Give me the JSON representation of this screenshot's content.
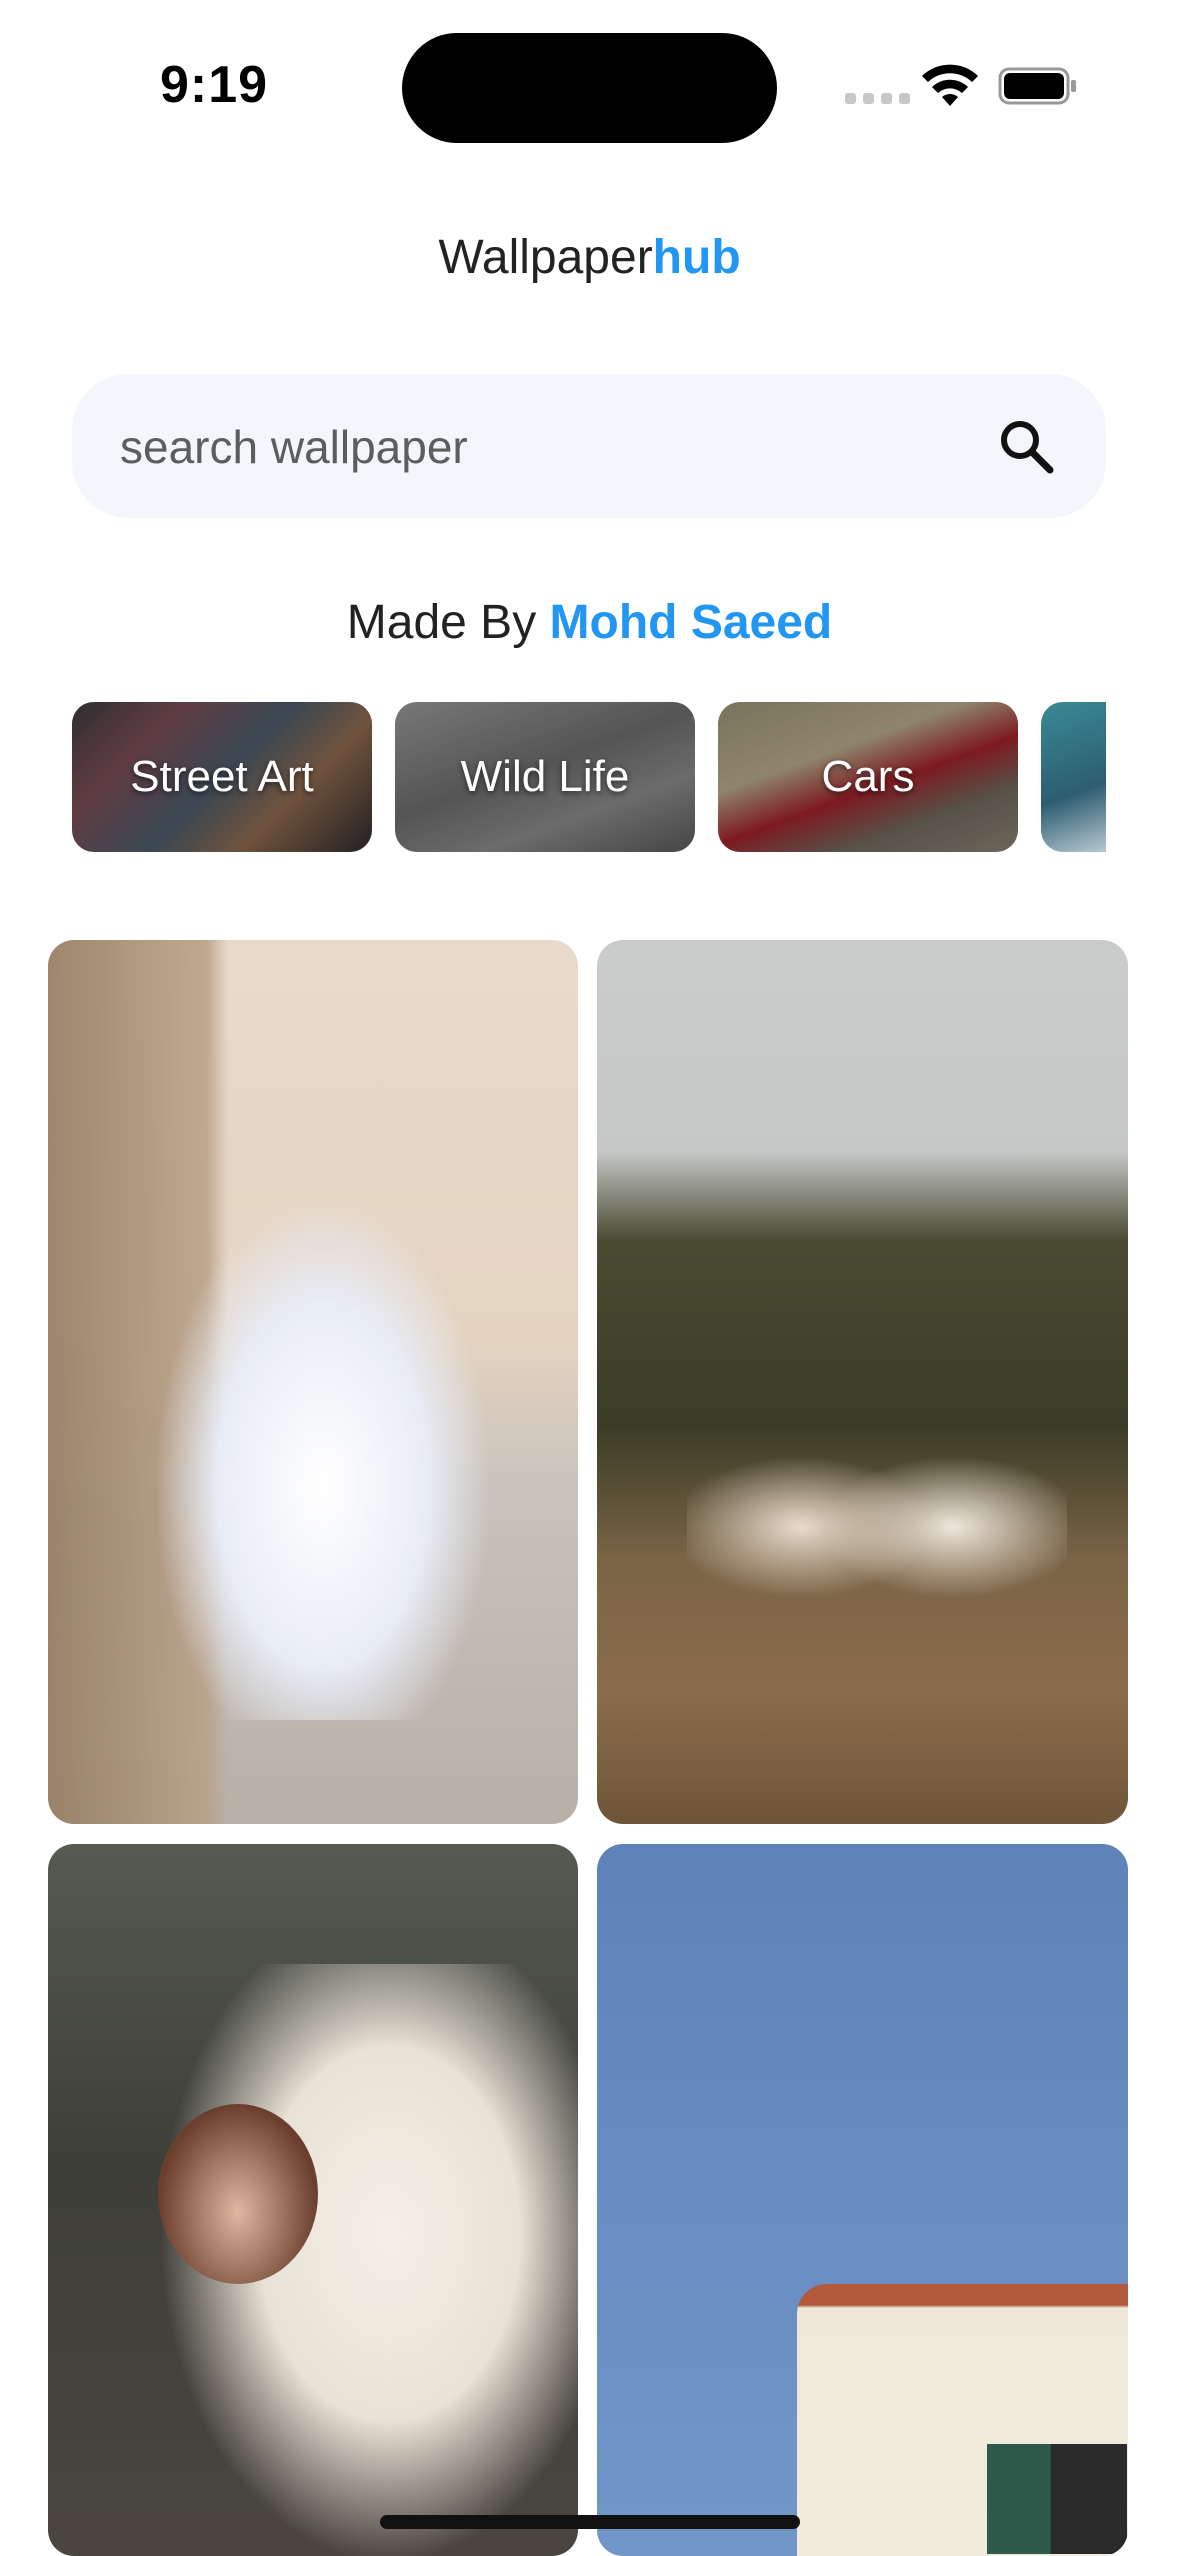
{
  "status_bar": {
    "time": "9:19"
  },
  "header": {
    "brand_main": "Wallpaper",
    "brand_accent": "hub"
  },
  "search": {
    "placeholder": "search wallpaper"
  },
  "credit": {
    "prefix": "Made By ",
    "name": "Mohd Saeed"
  },
  "categories": [
    {
      "label": "Street Art"
    },
    {
      "label": "Wild Life"
    },
    {
      "label": "Cars"
    },
    {
      "label": ""
    }
  ],
  "colors": {
    "accent": "#2196f3",
    "search_bg": "#f3f6fb"
  },
  "icons": {
    "search": "search-icon"
  }
}
